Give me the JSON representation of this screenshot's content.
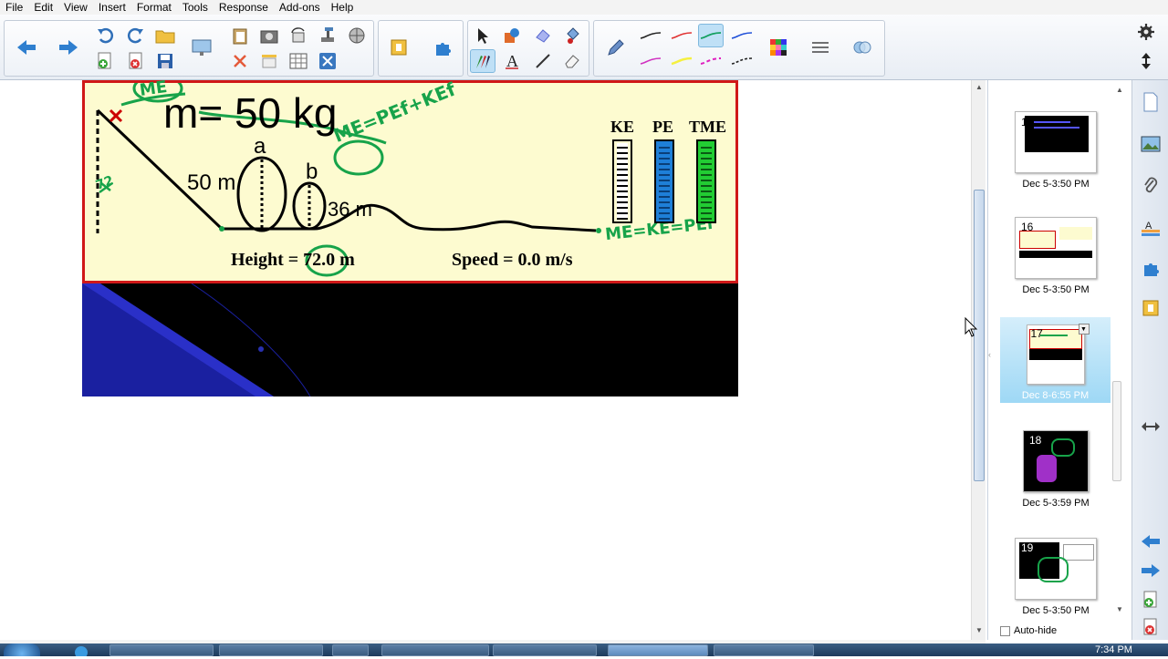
{
  "menu": [
    "File",
    "Edit",
    "View",
    "Insert",
    "Format",
    "Tools",
    "Response",
    "Add-ons",
    "Help"
  ],
  "slide": {
    "mass": "m= 50 kg",
    "label_a": "a",
    "label_b": "b",
    "height_50": "50 m",
    "height_36": "36 m",
    "height_readout": "Height = 72.0 m",
    "speed_readout": "Speed = 0.0 m/s",
    "bar_labels": [
      "KE",
      "PE",
      "TME"
    ],
    "bar_colors": [
      "#ffffff",
      "#1e7fd8",
      "#22cc33"
    ],
    "ink": {
      "me_top": "ME",
      "me_eq": "ME=PEf+KEf",
      "me_eq2": "ME=KE=PEi",
      "side_note": "72"
    }
  },
  "thumbnails": [
    {
      "num": "15",
      "date": "Dec 5-3:50 PM"
    },
    {
      "num": "16",
      "date": "Dec 5-3:50 PM"
    },
    {
      "num": "17",
      "date": "Dec 8-6:55 PM"
    },
    {
      "num": "18",
      "date": "Dec 5-3:59 PM"
    },
    {
      "num": "19",
      "date": "Dec 5-3:50 PM"
    }
  ],
  "autohide_label": "Auto-hide",
  "clock": "7:34 PM",
  "icons": {
    "back": "arrow-left-icon",
    "forward": "arrow-right-icon",
    "undo": "undo-icon",
    "redo": "redo-icon"
  }
}
